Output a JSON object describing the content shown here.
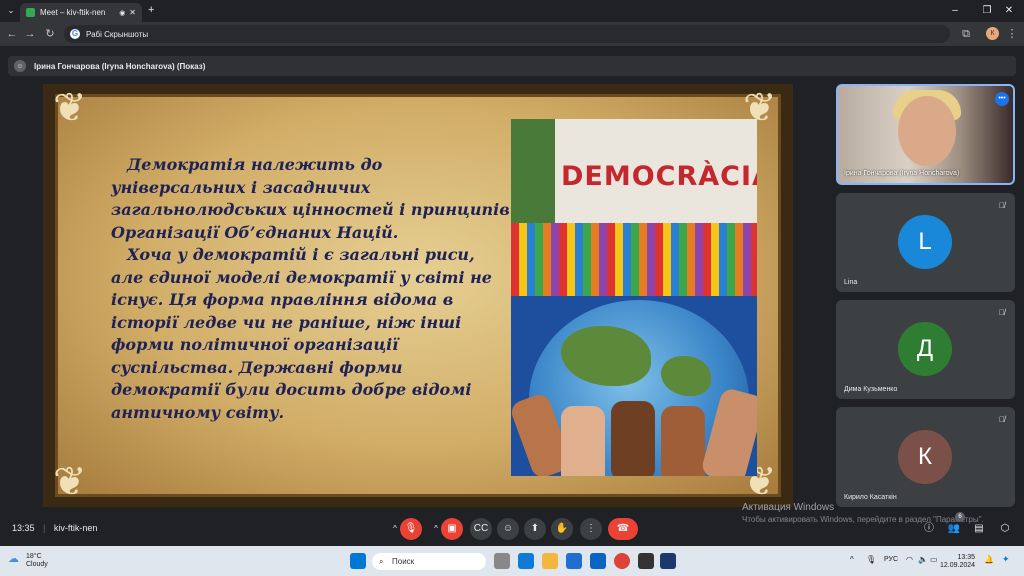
{
  "browser": {
    "tab_title": "Meet – kiv-ftik-nen",
    "address_text": "Рабі Скрыншоты"
  },
  "presenter": {
    "label": "Ірина Гончарова (Iryna Honcharova) (Показ)"
  },
  "slide": {
    "paragraphs": [
      "Демократія належить до універсальних і засадничих загальнолюдських цінностей і принципів Організації Об’єднаних Націй.",
      "Хоча у демократій і є загальні риси, але єдиної моделі демократії у світі не існує. Ця форма правління відома в історії ледве чи не раніше, ніж інші форми політичної організації суспільства. Державні форми демократії були досить добре відомі античному світу."
    ],
    "image_word": "DEMOCRÀCIA"
  },
  "participants": [
    {
      "name": "Ірина Гончарова (Iryna Honcharova)"
    },
    {
      "name": "Lina",
      "initial": "L",
      "color": "#1a88d8"
    },
    {
      "name": "Дима Кузьменко",
      "initial": "Д",
      "color": "#2e7d32"
    },
    {
      "name": "Кирило Касаткін",
      "initial": "К",
      "color": "#7b5048"
    }
  ],
  "controls": {
    "time": "13:35",
    "meeting_code": "kiv-ftik-nen",
    "people_badge": "6"
  },
  "watermark": {
    "line1": "Активация Windows",
    "line2": "Чтобы активировать Windows, перейдите в раздел \"Параметры\"."
  },
  "taskbar": {
    "temp": "18°C",
    "weather": "Cloudy",
    "search_placeholder": "Поиск",
    "lang": "РУС",
    "clock_time": "13:35",
    "clock_date": "12.09.2024"
  }
}
